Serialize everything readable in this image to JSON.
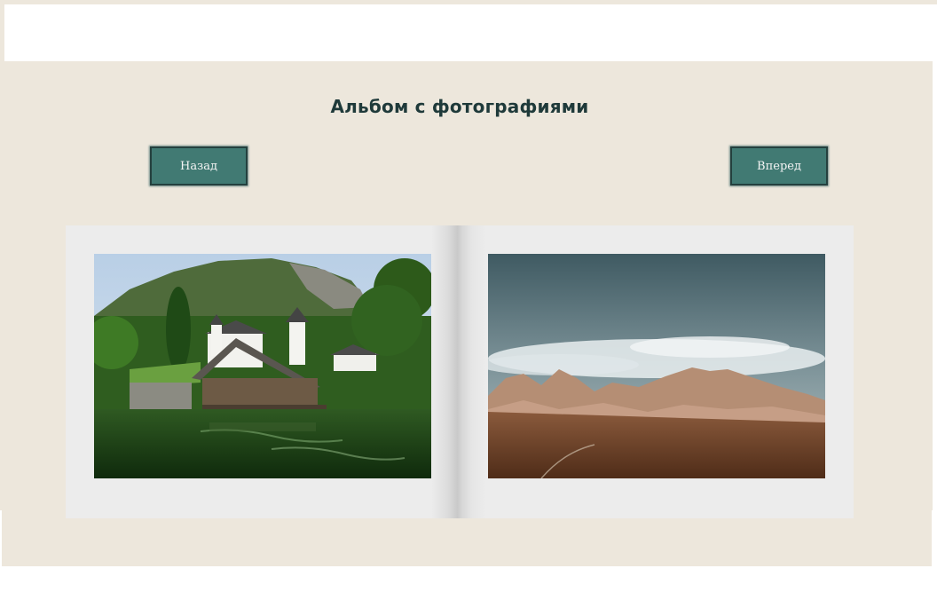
{
  "album": {
    "title": "Альбом с фотографиями"
  },
  "nav": {
    "back_label": "Назад",
    "next_label": "Вперед"
  },
  "colors": {
    "background": "#ede7dc",
    "button": "#417a73",
    "title": "#1f3a3a",
    "page": "#ececec"
  }
}
